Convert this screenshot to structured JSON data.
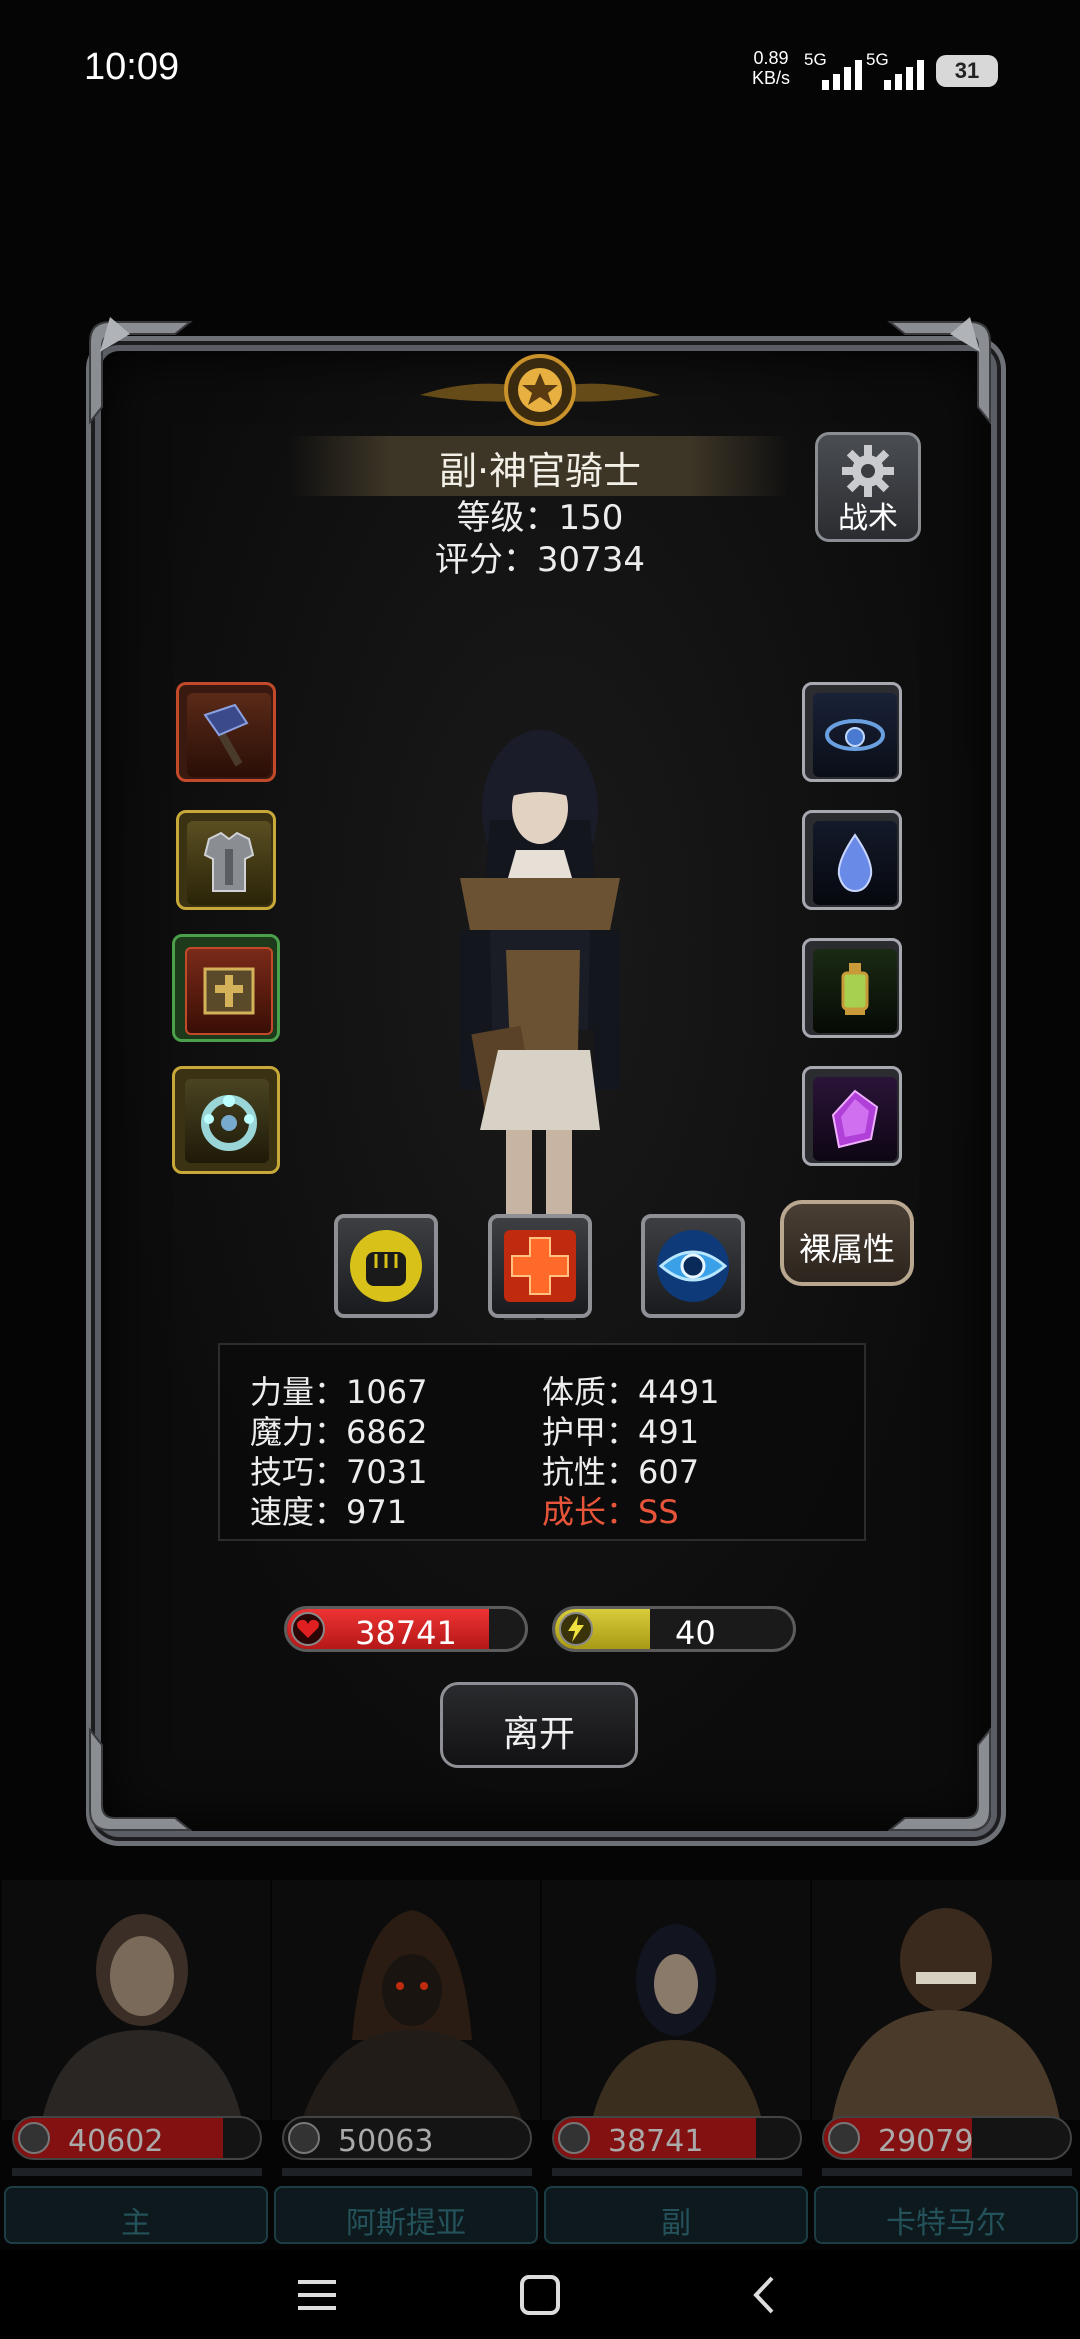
{
  "status_bar": {
    "time": "10:09",
    "net_speed_value": "0.89",
    "net_speed_unit": "KB/s",
    "signal_1_label": "5G",
    "signal_2_label": "5G",
    "battery": "31"
  },
  "character": {
    "name": "副·神官骑士",
    "level": "等级：150",
    "score": "评分：30734"
  },
  "buttons": {
    "tactics": "战术",
    "bare_attributes": "裸属性",
    "leave": "离开"
  },
  "equipment": {
    "left": [
      "war-hammer",
      "chest-armor",
      "holy-book",
      "jeweled-ring"
    ],
    "right": [
      "blue-amulet",
      "blue-gem-drop",
      "lantern",
      "purple-crystal"
    ]
  },
  "skills": [
    "fist-skill",
    "cross-heal-skill",
    "eye-skill"
  ],
  "stats": {
    "strength": "力量：1067",
    "constitution": "体质：4491",
    "magic": "魔力：6862",
    "armor": "护甲：491",
    "skill": "技巧：7031",
    "resistance": "抗性：607",
    "speed": "速度：971",
    "growth": "成长：SS"
  },
  "hp": {
    "value": "38741",
    "fill": 0.85
  },
  "energy": {
    "value": "40",
    "fill": 0.4
  },
  "party": [
    {
      "hp": "40602",
      "name": "主",
      "hp_fill": 0.85
    },
    {
      "hp": "50063",
      "name": "阿斯提亚",
      "hp_fill": 0.0
    },
    {
      "hp": "38741",
      "name": "副",
      "hp_fill": 0.82
    },
    {
      "hp": "29079",
      "name": "卡特马尔",
      "hp_fill": 0.6
    }
  ],
  "colors": {
    "growth_red": "#e8553a",
    "hp_red": "#d42020",
    "energy_yellow": "#c9bc2a",
    "frame_steel": "#6e7176"
  }
}
